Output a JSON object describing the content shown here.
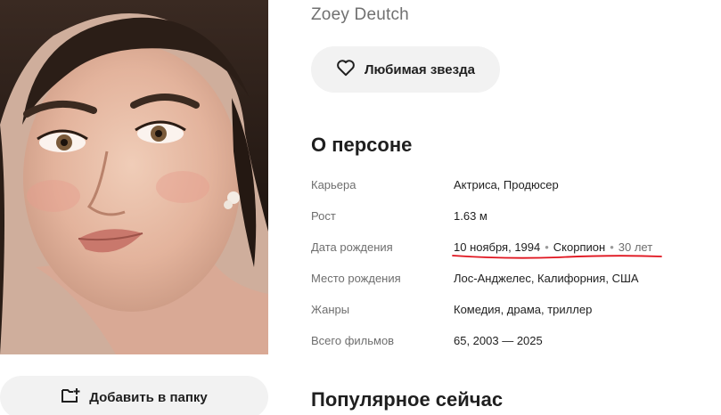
{
  "person": {
    "original_name": "Zoey Deutch",
    "favorite_button_label": "Любимая звезда",
    "add_to_folder_label": "Добавить в папку"
  },
  "about": {
    "title": "О персоне",
    "rows": [
      {
        "label": "Карьера",
        "value": "Актриса, Продюсер"
      },
      {
        "label": "Рост",
        "value": "1.63 м"
      },
      {
        "label": "Дата рождения",
        "date": "10 ноября, 1994",
        "zodiac": "Скорпион",
        "age": "30 лет",
        "sep": "•"
      },
      {
        "label": "Место рождения",
        "value": "Лос-Анджелес, Калифорния, США"
      },
      {
        "label": "Жанры",
        "value": "Комедия, драма, триллер"
      },
      {
        "label": "Всего фильмов",
        "value": "65, 2003 — 2025"
      }
    ]
  },
  "popular": {
    "title": "Популярное сейчас"
  },
  "icons": {
    "favorite": "heart-icon",
    "add_folder": "folder-plus-icon"
  },
  "colors": {
    "button_bg": "#f2f2f2",
    "annotation_red": "#e0141e",
    "label_gray": "#6e6e6e"
  }
}
